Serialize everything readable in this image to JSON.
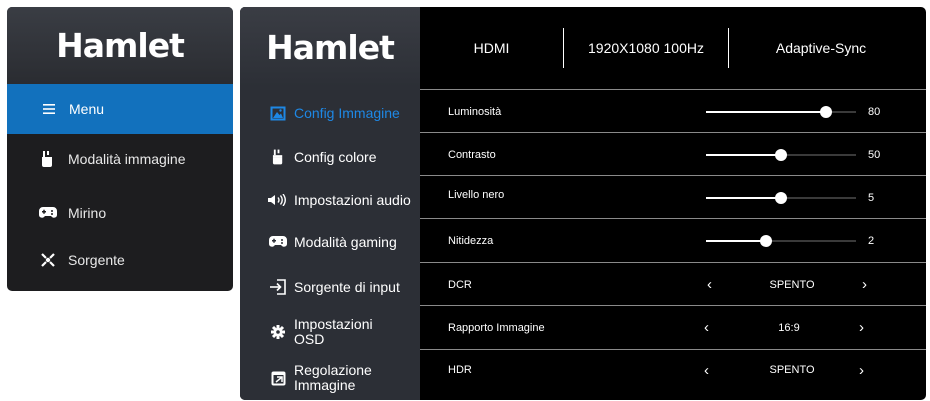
{
  "brand": "Hamlet",
  "quick_menu": {
    "items": [
      {
        "label": "Menu",
        "icon": "menu-icon",
        "active": true
      },
      {
        "label": "Modalità immagine",
        "icon": "paint-brush-icon",
        "active": false
      },
      {
        "label": "Mirino",
        "icon": "gamepad-icon",
        "active": false
      },
      {
        "label": "Sorgente",
        "icon": "source-icon",
        "active": false
      }
    ]
  },
  "status": {
    "input": "HDMI",
    "resolution": "1920X1080 100Hz",
    "sync": "Adaptive-Sync"
  },
  "sidebar": {
    "items": [
      {
        "label": "Config Immagine",
        "icon": "image-icon",
        "active": true
      },
      {
        "label": "Config colore",
        "icon": "paint-brush-icon",
        "active": false
      },
      {
        "label": "Impostazioni audio",
        "icon": "speaker-icon",
        "active": false
      },
      {
        "label": "Modalità gaming",
        "icon": "gamepad-icon",
        "active": false
      },
      {
        "label": "Sorgente di input",
        "icon": "input-icon",
        "active": false
      },
      {
        "label": "Impostazioni OSD",
        "icon": "gear-icon",
        "active": false
      },
      {
        "label": "Regolazione Immagine",
        "icon": "adjust-icon",
        "active": false
      }
    ]
  },
  "settings": {
    "brightness": {
      "label": "Luminosità",
      "value": 80,
      "max": 100
    },
    "contrast": {
      "label": "Contrasto",
      "value": 50,
      "max": 100
    },
    "black_level": {
      "label": "Livello nero",
      "value": 5,
      "max": 10
    },
    "sharpness": {
      "label": "Nitidezza",
      "value": 2,
      "max": 5
    },
    "dcr": {
      "label": "DCR",
      "value": "SPENTO"
    },
    "aspect_ratio": {
      "label": "Rapporto Immagine",
      "value": "16:9"
    },
    "hdr": {
      "label": "HDR",
      "value": "SPENTO"
    }
  },
  "colors": {
    "accent": "#1271bd",
    "active_text": "#1e88e5",
    "panel_bg": "#2c2f36",
    "content_bg": "#000000"
  }
}
